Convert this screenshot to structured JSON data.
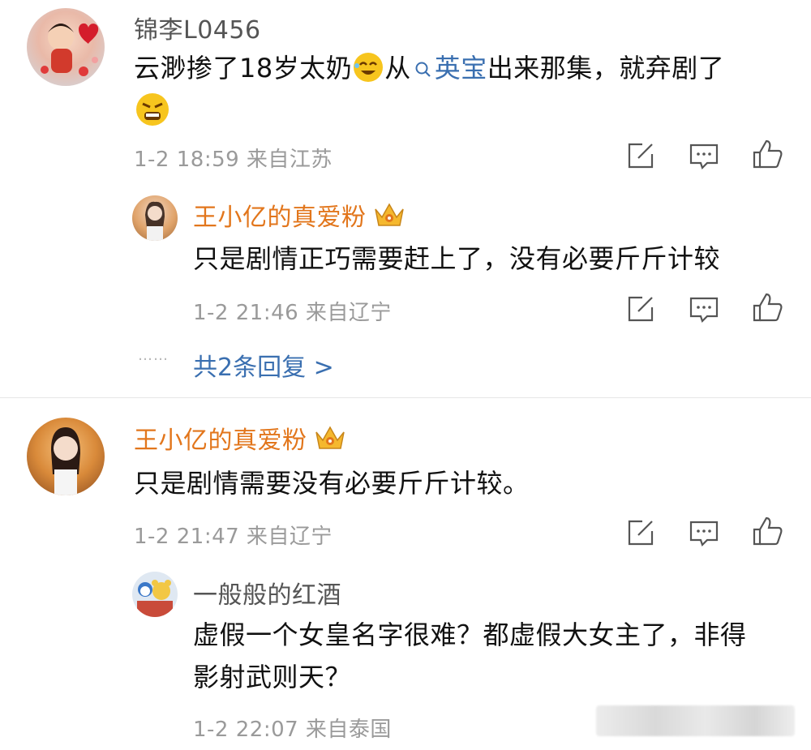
{
  "comments": [
    {
      "user": "锦李L0456",
      "text_before": "云渺掺了18岁太奶",
      "text_mid": "从",
      "link": "英宝",
      "text_after": "出来那集，就弃剧了",
      "meta": "1-2 18:59 来自江苏"
    },
    {
      "user": "王小亿的真爱粉",
      "text": "只是剧情正巧需要赶上了，没有必要斤斤计较",
      "meta": "1-2 21:46 来自辽宁"
    },
    {
      "more_replies": "共2条回复 >",
      "dots": "……"
    },
    {
      "user": "王小亿的真爱粉",
      "text": "只是剧情需要没有必要斤斤计较。",
      "meta": "1-2 21:47 来自辽宁"
    },
    {
      "user": "一般般的红酒",
      "text_line1": "虚假一个女皇名字很难？都虚假大女主了，非得",
      "text_line2": "影射武则天？",
      "meta": "1-2 22:07 来自泰国"
    }
  ],
  "colors": {
    "accent_orange": "#e2761c",
    "link_blue": "#3a6fb0",
    "meta_gray": "#9a9a9a"
  },
  "icons": [
    "edit-icon",
    "comment-icon",
    "like-icon",
    "crown-badge-icon",
    "search-icon"
  ]
}
